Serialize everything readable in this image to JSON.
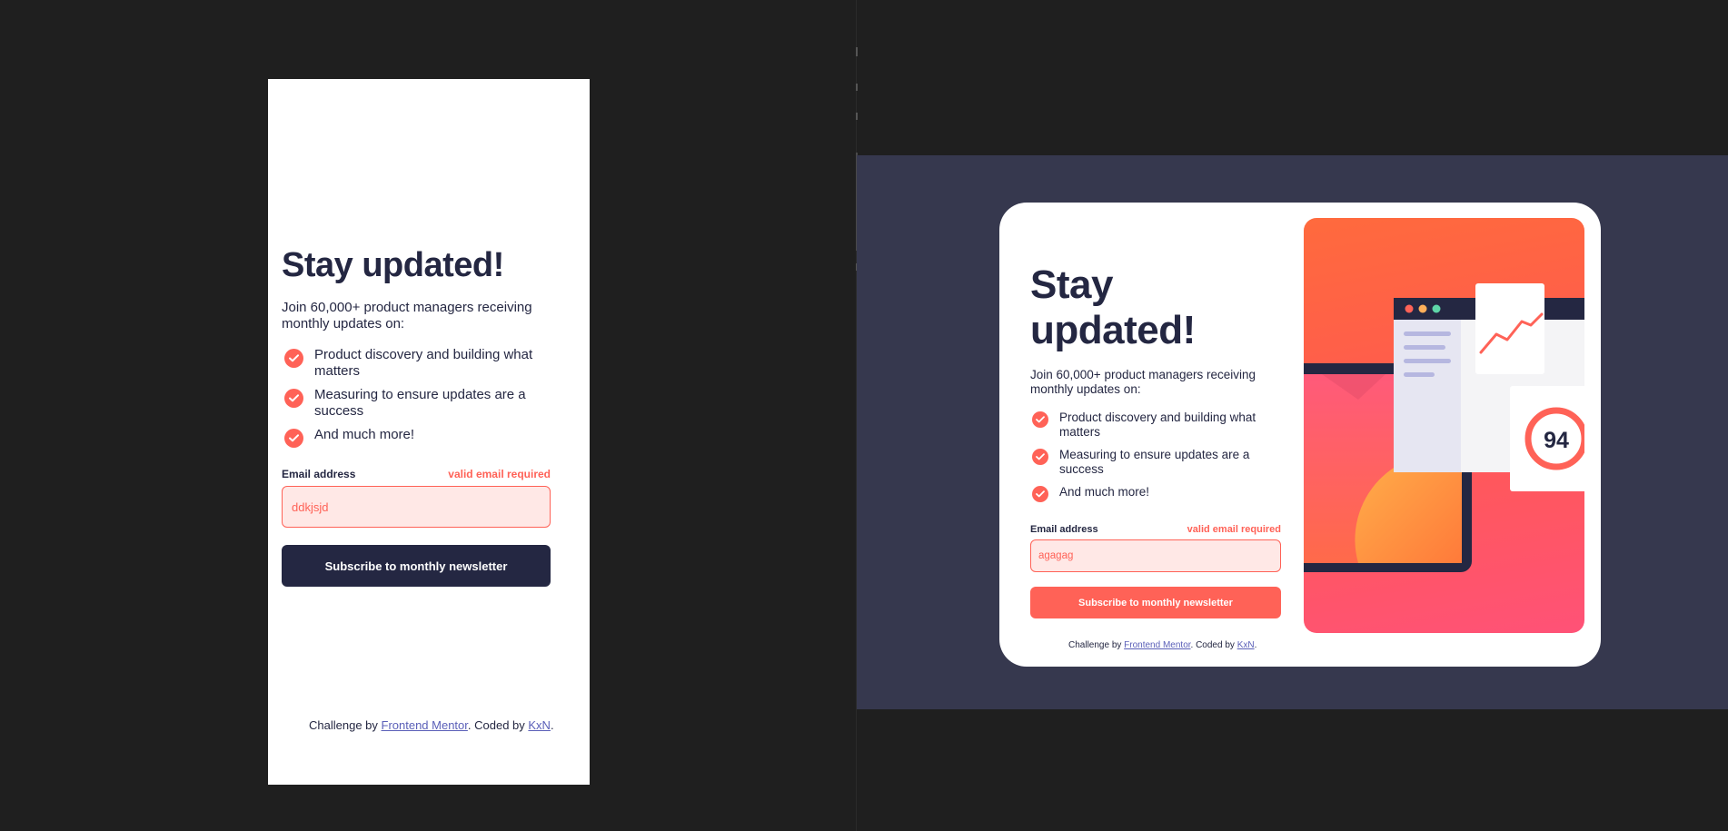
{
  "mobile": {
    "title": "Stay updated!",
    "intro": "Join 60,000+ product managers receiving monthly updates on:",
    "features": [
      "Product discovery and building what matters",
      "Measuring to ensure updates are a success",
      "And much more!"
    ],
    "email_label": "Email address",
    "error_text": "valid email required",
    "email_value": "ddkjsjd",
    "button_label": "Subscribe to monthly newsletter",
    "footer": {
      "prefix": "Challenge by ",
      "link1": "Frontend Mentor",
      "middle": ". Coded by ",
      "link2": "KxN",
      "suffix": "."
    }
  },
  "desktop": {
    "title": "Stay updated!",
    "intro": "Join 60,000+ product managers receiving monthly updates on:",
    "features": [
      "Product discovery and building what matters",
      "Measuring to ensure updates are a success",
      "And much more!"
    ],
    "email_label": "Email address",
    "error_text": "valid email required",
    "email_value": "agagag",
    "button_label": "Subscribe to monthly newsletter",
    "footer": {
      "prefix": "Challenge by ",
      "link1": "Frontend Mentor",
      "middle": ". Coded by ",
      "link2": "KxN",
      "suffix": "."
    },
    "illustration_score": "94"
  },
  "colors": {
    "background": "#1f1f1f",
    "desktop_bg": "#36384e",
    "dark_navy": "#242742",
    "tomato": "#ff6257",
    "error_bg": "#ffe8e6"
  },
  "icons": [
    "check-icon"
  ]
}
